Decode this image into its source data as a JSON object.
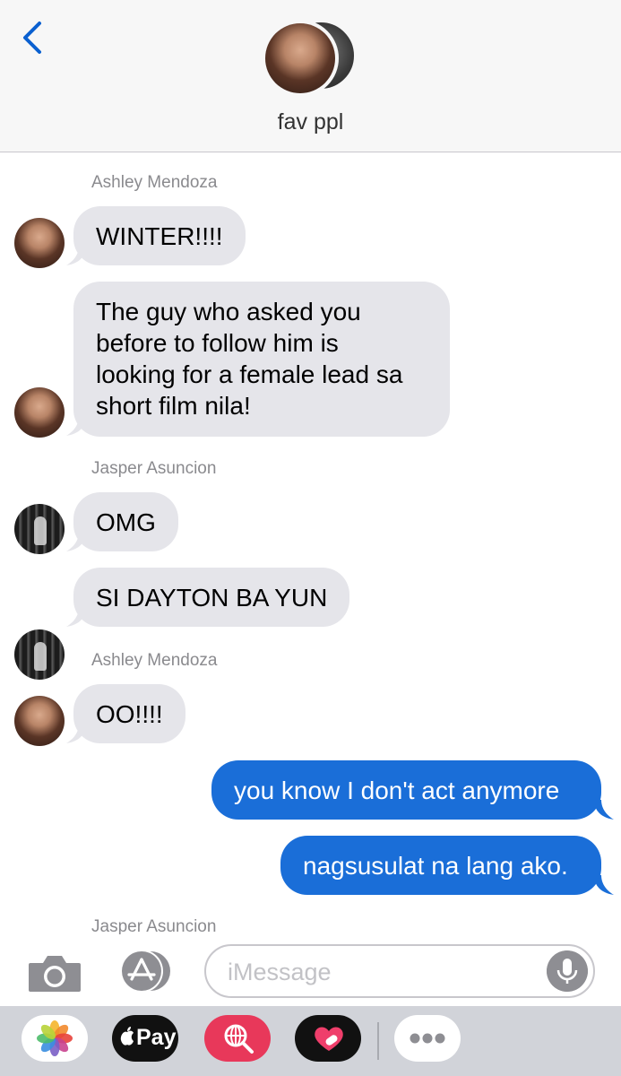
{
  "header": {
    "group_name": "fav ppl"
  },
  "messages": [
    {
      "sender": "Ashley Mendoza",
      "text": "WINTER!!!!",
      "direction": "incoming"
    },
    {
      "sender": "Ashley Mendoza",
      "lines": [
        "The guy who asked you",
        "before to follow him is",
        "looking for a female lead sa",
        "short film nila!"
      ],
      "direction": "incoming"
    },
    {
      "sender": "Jasper Asuncion",
      "text": "OMG",
      "direction": "incoming"
    },
    {
      "sender": "Jasper Asuncion",
      "text": "SI DAYTON BA YUN",
      "direction": "incoming"
    },
    {
      "sender": "Ashley Mendoza",
      "text": "OO!!!!",
      "direction": "incoming"
    },
    {
      "sender": "me",
      "text": "you know I don't act anymore",
      "direction": "outgoing"
    },
    {
      "sender": "me",
      "text": "nagsusulat na lang ako.",
      "direction": "outgoing"
    }
  ],
  "sender_labels": [
    "Ashley Mendoza",
    "Jasper Asuncion",
    "Ashley Mendoza",
    "Jasper Asuncion"
  ],
  "input": {
    "placeholder": "iMessage"
  },
  "apps": {
    "apple_pay_label": "Pay"
  },
  "icons": [
    "back-chevron-icon",
    "camera-icon",
    "app-store-icon",
    "microphone-icon",
    "photos-icon",
    "apple-icon",
    "search-globe-icon",
    "heart-digital-touch-icon",
    "more-icon"
  ],
  "colors": {
    "incoming_bubble": "#e5e5ea",
    "outgoing_bubble": "#1a6ed8",
    "accent": "#0a60d0"
  }
}
